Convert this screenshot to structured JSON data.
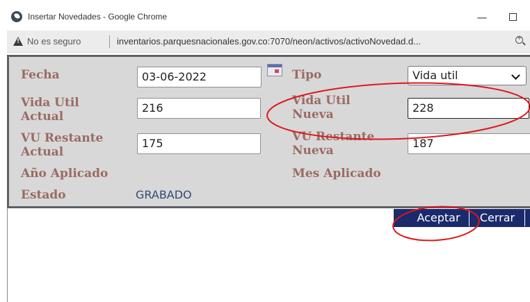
{
  "window": {
    "title": "Insertar Novedades - Google Chrome",
    "minimize_glyph": "—",
    "close_glyph": "✕"
  },
  "addressbar": {
    "security_text": "No es seguro",
    "url": "inventarios.parquesnacionales.gov.co:7070/neon/activos/activoNovedad.d..."
  },
  "form": {
    "fecha_label": "Fecha",
    "fecha_value": "03-06-2022",
    "tipo_label": "Tipo",
    "tipo_value": "Vida util",
    "vida_util_actual_label_1": "Vida Util",
    "vida_util_actual_label_2": "Actual",
    "vida_util_actual_value": "216",
    "vida_util_nueva_label_1": "Vida Util",
    "vida_util_nueva_label_2": "Nueva",
    "vida_util_nueva_value": "228",
    "vu_restante_actual_label_1": "VU Restante",
    "vu_restante_actual_label_2": "Actual",
    "vu_restante_actual_value": "175",
    "vu_restante_nueva_label_1": "VU Restante",
    "vu_restante_nueva_label_2": "Nueva",
    "vu_restante_nueva_value": "187",
    "anio_aplicado_label": "Año Aplicado",
    "mes_aplicado_label": "Mes Aplicado",
    "estado_label": "Estado",
    "estado_value": "GRABADO"
  },
  "buttons": {
    "aceptar": "Aceptar",
    "cerrar": "Cerrar"
  },
  "colors": {
    "label": "#9a6a63",
    "value": "#334875",
    "button_bg": "#1b2a6b",
    "annotation": "#e0151b"
  }
}
